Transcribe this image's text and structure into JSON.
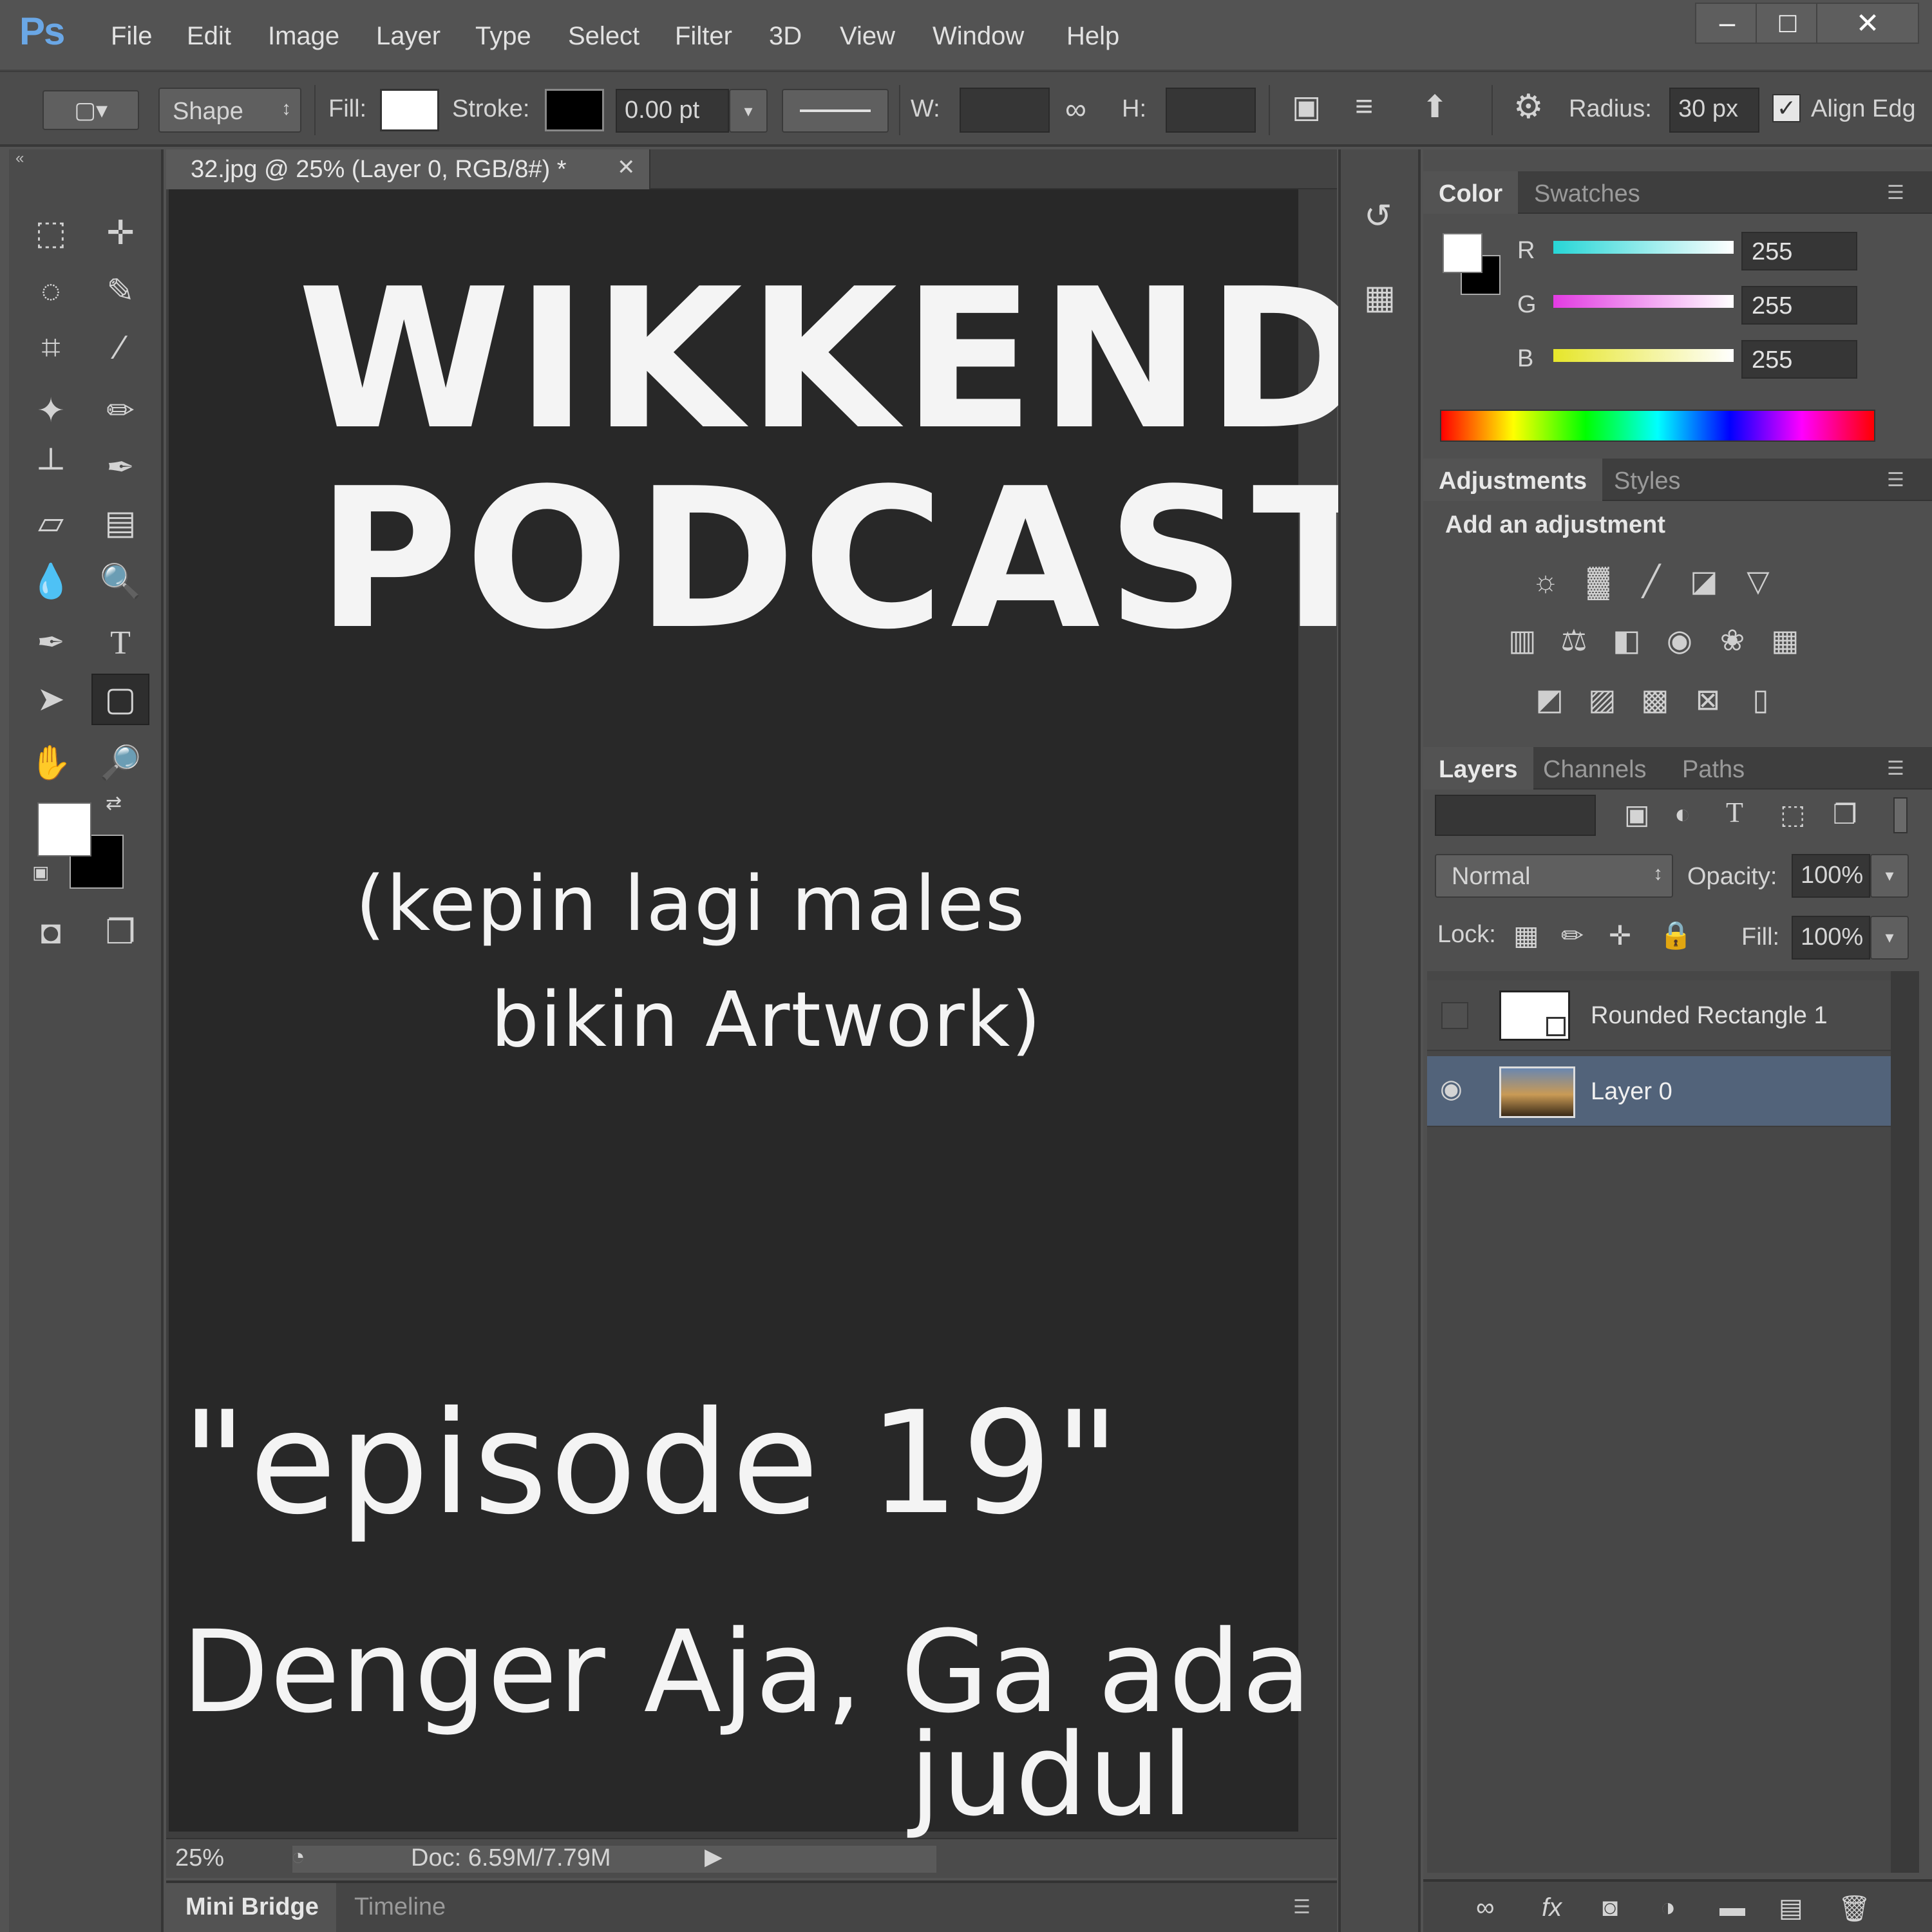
{
  "app": {
    "logo": "Ps",
    "menu": [
      "File",
      "Edit",
      "Image",
      "Layer",
      "Type",
      "Select",
      "Filter",
      "3D",
      "View",
      "Window",
      "Help"
    ],
    "window_controls": [
      "minimize-icon",
      "maximize-icon",
      "close-icon"
    ]
  },
  "options": {
    "mode_value": "Shape",
    "fill_label": "Fill:",
    "fill_color": "#ffffff",
    "stroke_label": "Stroke:",
    "stroke_color": "#000000",
    "stroke_width": "0.00 pt",
    "w_label": "W:",
    "h_label": "H:",
    "radius_label": "Radius:",
    "radius_value": "30 px",
    "align_edges_label": "Align Edg"
  },
  "document": {
    "tab_title": "32.jpg @ 25% (Layer 0, RGB/8#) *",
    "canvas_text": {
      "line1": "WIKKEND",
      "line2": "PODCAST",
      "line3": "(kepin lagi males",
      "line4": "bikin Artwork)",
      "line5": "\"episode 19\"",
      "line6": "Denger Aja, Ga ada",
      "line7": "judul"
    },
    "status": {
      "zoom": "25%",
      "doc_size": "Doc: 6.59M/7.79M"
    },
    "bottom_tabs": [
      "Mini Bridge",
      "Timeline"
    ]
  },
  "color_panel": {
    "tabs": [
      "Color",
      "Swatches"
    ],
    "channels": [
      {
        "label": "R",
        "value": "255",
        "color": "#27d6d6"
      },
      {
        "label": "G",
        "value": "255",
        "color": "#e23be2"
      },
      {
        "label": "B",
        "value": "255",
        "color": "#e6e62a"
      }
    ],
    "foreground": "#ffffff",
    "background": "#000000"
  },
  "adjustments_panel": {
    "tabs": [
      "Adjustments",
      "Styles"
    ],
    "heading": "Add an adjustment"
  },
  "layers_panel": {
    "tabs": [
      "Layers",
      "Channels",
      "Paths"
    ],
    "blend_mode": "Normal",
    "opacity_label": "Opacity:",
    "opacity_value": "100%",
    "lock_label": "Lock:",
    "fill_label": "Fill:",
    "fill_value": "100%",
    "layers": [
      {
        "name": "Rounded Rectangle 1",
        "visible": false,
        "selected": false
      },
      {
        "name": "Layer 0",
        "visible": true,
        "selected": true
      }
    ]
  }
}
